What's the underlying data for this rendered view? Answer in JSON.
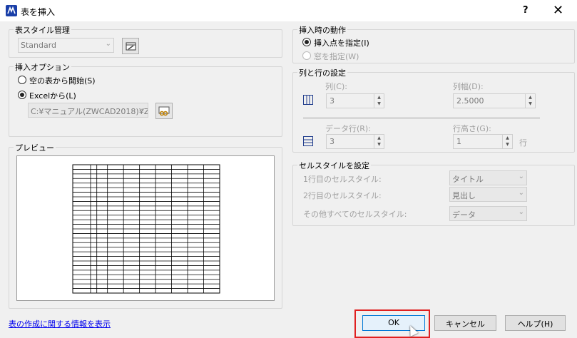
{
  "window": {
    "title": "表を挿入",
    "help": "?",
    "close": "✕"
  },
  "table_style": {
    "label": "表スタイル管理",
    "value": "Standard"
  },
  "insert_options": {
    "label": "挿入オプション",
    "empty_table": "空の表から開始(S)",
    "from_excel": "Excelから(L)",
    "excel_path": "C:¥マニュアル(ZWCAD2018)¥Z"
  },
  "preview": {
    "label": "プレビュー",
    "rows": 28,
    "cols": 10
  },
  "insert_behavior": {
    "label": "挿入時の動作",
    "specify_point": "挿入点を指定(I)",
    "specify_window": "窓を指定(W)"
  },
  "rows_cols": {
    "label": "列と行の設定",
    "columns_label": "列(C):",
    "columns_value": "3",
    "col_width_label": "列幅(D):",
    "col_width_value": "2.5000",
    "data_rows_label": "データ行(R):",
    "data_rows_value": "3",
    "row_height_label": "行高さ(G):",
    "row_height_value": "1",
    "row_unit": "行"
  },
  "cell_styles": {
    "label": "セルスタイルを設定",
    "first_row_label": "1行目のセルスタイル:",
    "first_row_value": "タイトル",
    "second_row_label": "2行目のセルスタイル:",
    "second_row_value": "見出し",
    "other_rows_label": "その他すべてのセルスタイル:",
    "other_rows_value": "データ"
  },
  "footer": {
    "info_link": "表の作成に関する情報を表示",
    "ok": "OK",
    "cancel": "キャンセル",
    "help": "ヘルプ(H)"
  }
}
